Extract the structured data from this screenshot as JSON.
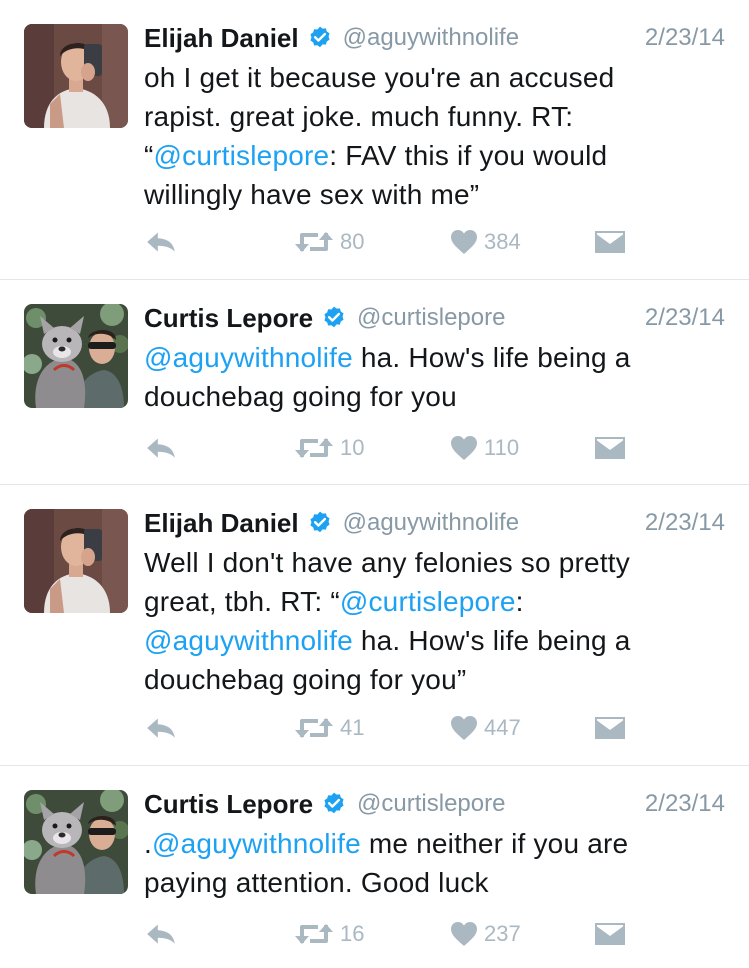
{
  "tweets": [
    {
      "name": "Elijah Daniel",
      "handle": "@aguywithnolife",
      "date": "2/23/14",
      "avatar": "selfie-avatar",
      "text": {
        "l1": "oh I get it because you're an accused",
        "l2": "rapist. great joke. much funny. RT:",
        "l3a": "“",
        "l3m": "@curtislepore",
        "l3b": ": FAV this if you would",
        "l4": "willingly have sex with me”"
      },
      "retweets": "80",
      "likes": "384"
    },
    {
      "name": "Curtis Lepore",
      "handle": "@curtislepore",
      "date": "2/23/14",
      "avatar": "dog-avatar",
      "text": {
        "l1m": "@aguywithnolife",
        "l1b": " ha. How's life being a",
        "l2": "douchebag going for you"
      },
      "retweets": "10",
      "likes": "110"
    },
    {
      "name": "Elijah Daniel",
      "handle": "@aguywithnolife",
      "date": "2/23/14",
      "avatar": "selfie-avatar",
      "text": {
        "l1": "Well I don't have any felonies so pretty",
        "l2a": "great, tbh. RT: “",
        "l2m": "@curtislepore",
        "l2b": ":",
        "l3m": "@aguywithnolife",
        "l3b": " ha. How's life being a",
        "l4": "douchebag going for you”"
      },
      "retweets": "41",
      "likes": "447"
    },
    {
      "name": "Curtis Lepore",
      "handle": "@curtislepore",
      "date": "2/23/14",
      "avatar": "dog-avatar",
      "text": {
        "l1a": ".",
        "l1m": "@aguywithnolife",
        "l1b": " me neither if you are",
        "l2": "paying attention. Good luck"
      },
      "retweets": "16",
      "likes": "237"
    }
  ],
  "icons": {
    "reply": "reply-icon",
    "retweet": "retweet-icon",
    "like": "heart-icon",
    "dm": "direct-message-icon",
    "verified": "verified-badge-icon"
  },
  "colors": {
    "mention": "#1da1f2",
    "verified": "#1da1f2",
    "meta": "#8899a6",
    "action": "#aab8c2"
  }
}
